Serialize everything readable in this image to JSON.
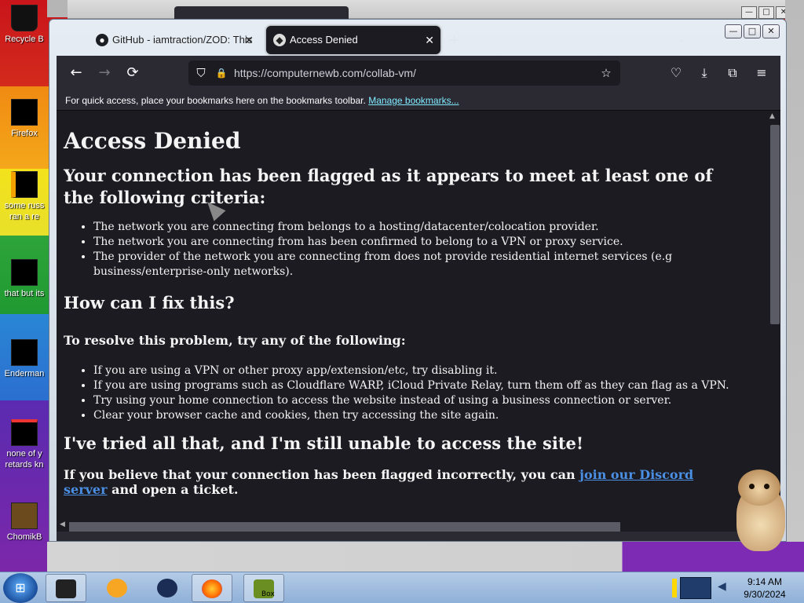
{
  "desktop": {
    "icons": [
      {
        "label": "Recycle B"
      },
      {
        "label": "Firefox"
      },
      {
        "label": "some russ\nran a re"
      },
      {
        "label": "that but its"
      },
      {
        "label": "Enderman"
      },
      {
        "label": "none of y\nretards kn"
      },
      {
        "label": "ChomikB"
      }
    ]
  },
  "window": {
    "controls": {
      "minimize": "—",
      "maximize": "□",
      "close": "✕"
    }
  },
  "tabs": [
    {
      "title": "GitHub - iamtraction/ZOD: This",
      "icon": "github-icon",
      "close": "✕"
    },
    {
      "title": "Access Denied",
      "icon": "page-icon",
      "close": "✕"
    }
  ],
  "new_tab_label": "+",
  "list_tabs_icon": "chevron-down-icon",
  "navbar": {
    "back": "←",
    "forward": "→",
    "reload": "⟳",
    "url": "https://computernewb.com/collab-vm/",
    "shield": "⛉",
    "lock": "🔒",
    "bookmark_star": "☆",
    "pocket": "♡",
    "downloads": "⤓",
    "extensions": "⧉",
    "menu": "≡"
  },
  "bookmarks_bar": {
    "text": "For quick access, place your bookmarks here on the bookmarks toolbar.",
    "link": "Manage bookmarks..."
  },
  "page": {
    "title": "Access Denied",
    "subtitle": "Your connection has been flagged as it appears to meet at least one of the following criteria:",
    "criteria": [
      "The network you are connecting from belongs to a hosting/datacenter/colocation provider.",
      "The network you are connecting from has been confirmed to belong to a VPN or proxy service.",
      "The provider of the network you are connecting from does not provide residential internet services (e.g business/enterprise-only networks)."
    ],
    "fix_heading": "How can I fix this?",
    "resolve_heading": "To resolve this problem, try any of the following:",
    "fixes": [
      "If you are using a VPN or other proxy app/extension/etc, try disabling it.",
      "If you are using programs such as Cloudflare WARP, iCloud Private Relay, turn them off as they can flag as a VPN.",
      "Try using your home connection to access the website instead of using a business connection or server.",
      "Clear your browser cache and cookies, then try accessing the site again."
    ],
    "tried_heading": "I've tried all that, and I'm still unable to access the site!",
    "final_before": "If you believe that your connection has been flagged incorrectly, you can ",
    "final_link": "join our Discord server",
    "final_after": " and open a ticket."
  },
  "taskbar": {
    "time": "9:14 AM",
    "date": "9/30/2024",
    "box_label": "Box"
  }
}
